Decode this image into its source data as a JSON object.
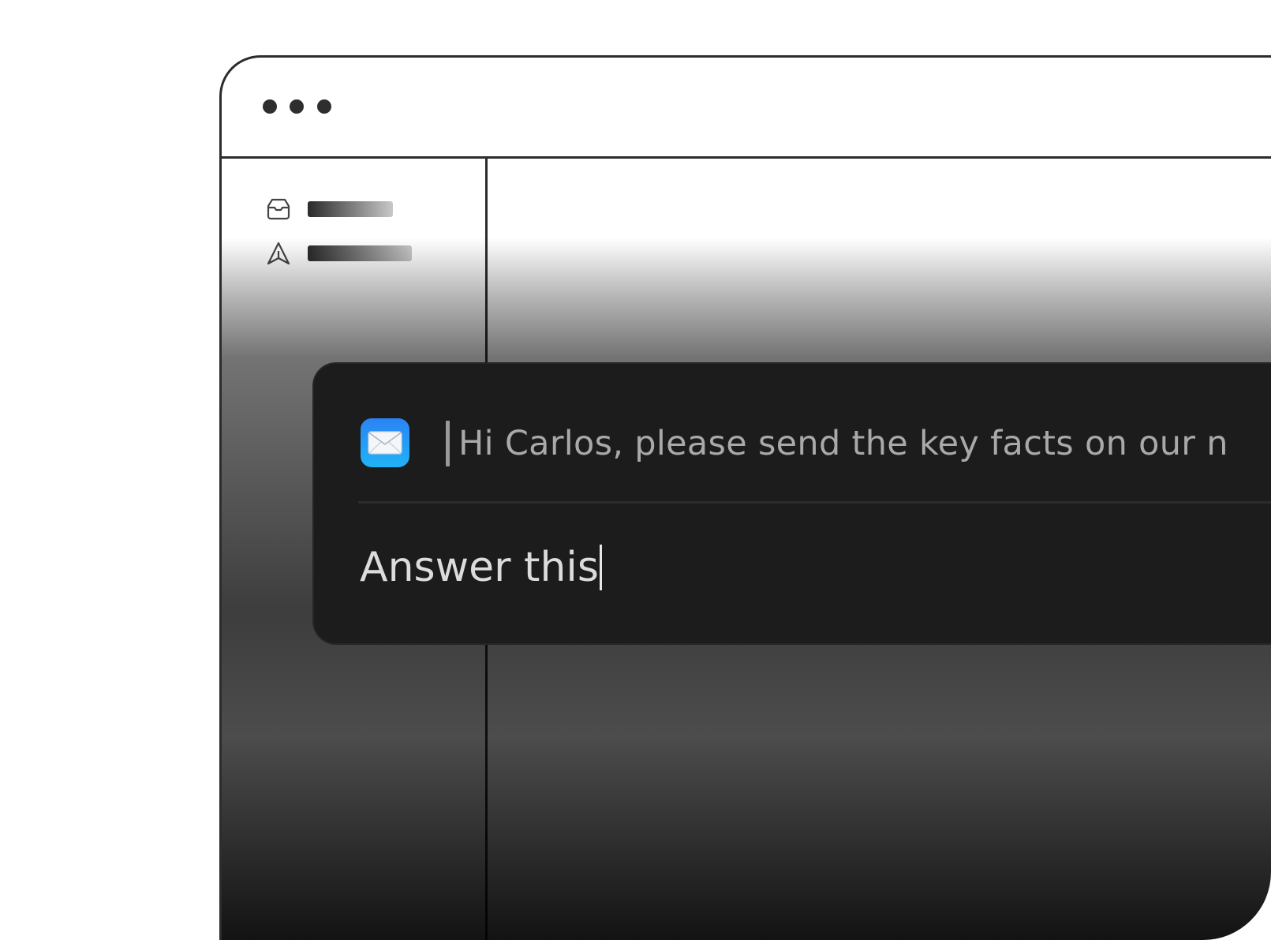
{
  "window": {
    "title_dots": [
      "dot-1",
      "dot-2",
      "dot-3"
    ],
    "sidebar": {
      "items": [
        {
          "icon": "inbox-icon"
        },
        {
          "icon": "send-icon"
        }
      ]
    }
  },
  "overlay": {
    "app_icon": "mail-icon",
    "context_text": "Hi Carlos, please send the key facts on our n",
    "input_value": "Answer this"
  }
}
